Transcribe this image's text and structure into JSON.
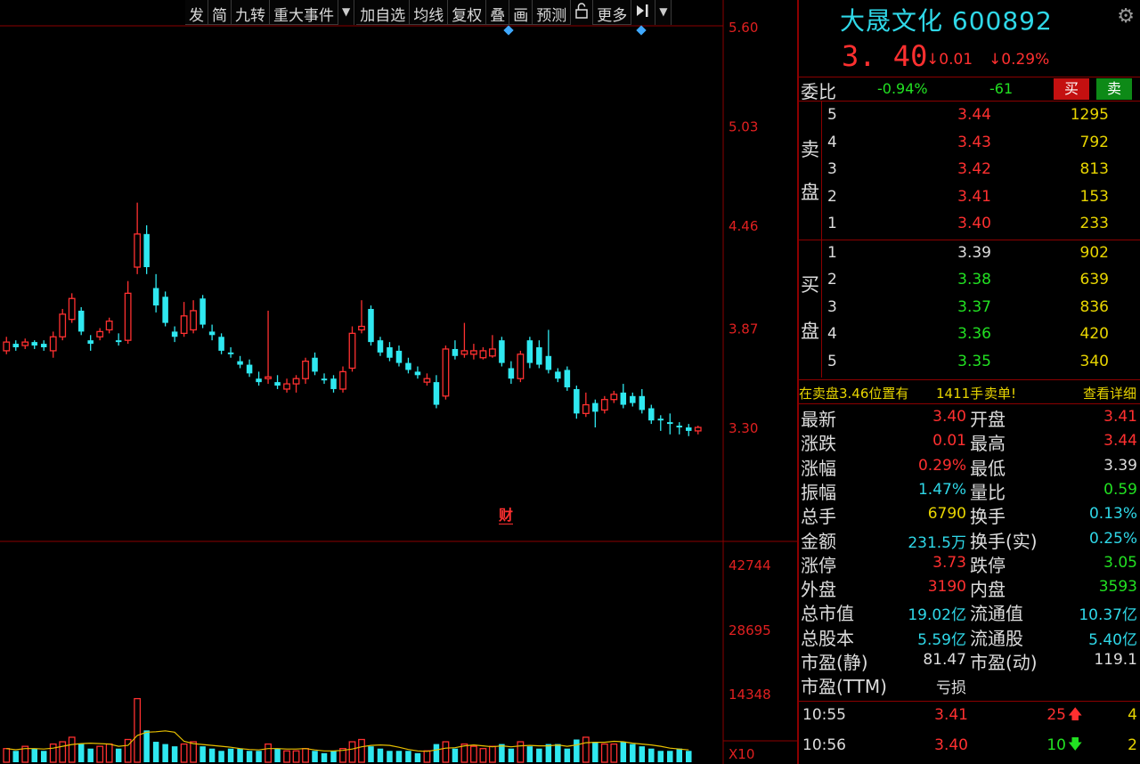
{
  "toolbar": {
    "items": [
      "发",
      "简",
      "九转",
      "重大事件",
      "加自选",
      "均线",
      "复权",
      "叠",
      "画",
      "预测",
      "更多"
    ]
  },
  "chart_data": {
    "type": "candlestick",
    "price_axis": {
      "ticks": [
        "5.60",
        "5.03",
        "4.46",
        "3.87",
        "3.30"
      ],
      "ylim": [
        3.3,
        5.6
      ]
    },
    "volume_axis": {
      "ticks": [
        "42744",
        "28695",
        "14348"
      ],
      "unit_label": "X10"
    },
    "candles": [
      {
        "o": 3.74,
        "c": 3.79,
        "h": 3.82,
        "l": 3.72
      },
      {
        "o": 3.78,
        "c": 3.76,
        "h": 3.8,
        "l": 3.74
      },
      {
        "o": 3.77,
        "c": 3.79,
        "h": 3.81,
        "l": 3.75
      },
      {
        "o": 3.79,
        "c": 3.77,
        "h": 3.8,
        "l": 3.75
      },
      {
        "o": 3.78,
        "c": 3.76,
        "h": 3.8,
        "l": 3.74
      },
      {
        "o": 3.74,
        "c": 3.82,
        "h": 3.85,
        "l": 3.7
      },
      {
        "o": 3.82,
        "c": 3.95,
        "h": 3.98,
        "l": 3.8
      },
      {
        "o": 3.92,
        "c": 4.04,
        "h": 4.07,
        "l": 3.9
      },
      {
        "o": 3.97,
        "c": 3.85,
        "h": 3.99,
        "l": 3.83
      },
      {
        "o": 3.8,
        "c": 3.78,
        "h": 3.83,
        "l": 3.74
      },
      {
        "o": 3.82,
        "c": 3.85,
        "h": 3.87,
        "l": 3.8
      },
      {
        "o": 3.86,
        "c": 3.91,
        "h": 3.93,
        "l": 3.84
      },
      {
        "o": 3.8,
        "c": 3.79,
        "h": 3.84,
        "l": 3.77
      },
      {
        "o": 3.8,
        "c": 4.07,
        "h": 4.14,
        "l": 3.78
      },
      {
        "o": 4.22,
        "c": 4.41,
        "h": 4.59,
        "l": 4.18
      },
      {
        "o": 4.41,
        "c": 4.22,
        "h": 4.46,
        "l": 4.18
      },
      {
        "o": 4.1,
        "c": 4.0,
        "h": 4.18,
        "l": 3.96
      },
      {
        "o": 4.05,
        "c": 3.9,
        "h": 4.08,
        "l": 3.88
      },
      {
        "o": 3.85,
        "c": 3.82,
        "h": 3.88,
        "l": 3.79
      },
      {
        "o": 3.84,
        "c": 3.94,
        "h": 4.02,
        "l": 3.82
      },
      {
        "o": 3.86,
        "c": 3.97,
        "h": 4.03,
        "l": 3.84
      },
      {
        "o": 4.04,
        "c": 3.89,
        "h": 4.06,
        "l": 3.87
      },
      {
        "o": 3.85,
        "c": 3.83,
        "h": 3.89,
        "l": 3.8
      },
      {
        "o": 3.82,
        "c": 3.74,
        "h": 3.84,
        "l": 3.72
      },
      {
        "o": 3.73,
        "c": 3.72,
        "h": 3.76,
        "l": 3.7
      },
      {
        "o": 3.68,
        "c": 3.66,
        "h": 3.71,
        "l": 3.64
      },
      {
        "o": 3.66,
        "c": 3.61,
        "h": 3.69,
        "l": 3.59
      },
      {
        "o": 3.58,
        "c": 3.56,
        "h": 3.62,
        "l": 3.54
      },
      {
        "o": 3.58,
        "c": 3.59,
        "h": 3.97,
        "l": 3.55
      },
      {
        "o": 3.56,
        "c": 3.54,
        "h": 3.6,
        "l": 3.52
      },
      {
        "o": 3.52,
        "c": 3.55,
        "h": 3.58,
        "l": 3.5
      },
      {
        "o": 3.55,
        "c": 3.58,
        "h": 3.6,
        "l": 3.5
      },
      {
        "o": 3.58,
        "c": 3.68,
        "h": 3.7,
        "l": 3.55
      },
      {
        "o": 3.7,
        "c": 3.62,
        "h": 3.73,
        "l": 3.6
      },
      {
        "o": 3.58,
        "c": 3.57,
        "h": 3.61,
        "l": 3.55
      },
      {
        "o": 3.58,
        "c": 3.52,
        "h": 3.6,
        "l": 3.5
      },
      {
        "o": 3.52,
        "c": 3.62,
        "h": 3.65,
        "l": 3.5
      },
      {
        "o": 3.64,
        "c": 3.84,
        "h": 3.88,
        "l": 3.62
      },
      {
        "o": 3.86,
        "c": 3.88,
        "h": 4.03,
        "l": 3.84
      },
      {
        "o": 3.98,
        "c": 3.79,
        "h": 4.0,
        "l": 3.77
      },
      {
        "o": 3.8,
        "c": 3.73,
        "h": 3.82,
        "l": 3.71
      },
      {
        "o": 3.76,
        "c": 3.7,
        "h": 3.79,
        "l": 3.68
      },
      {
        "o": 3.74,
        "c": 3.67,
        "h": 3.77,
        "l": 3.65
      },
      {
        "o": 3.67,
        "c": 3.63,
        "h": 3.7,
        "l": 3.61
      },
      {
        "o": 3.62,
        "c": 3.6,
        "h": 3.65,
        "l": 3.58
      },
      {
        "o": 3.56,
        "c": 3.58,
        "h": 3.61,
        "l": 3.54
      },
      {
        "o": 3.56,
        "c": 3.43,
        "h": 3.6,
        "l": 3.41
      },
      {
        "o": 3.48,
        "c": 3.75,
        "h": 3.77,
        "l": 3.46
      },
      {
        "o": 3.75,
        "c": 3.71,
        "h": 3.8,
        "l": 3.69
      },
      {
        "o": 3.72,
        "c": 3.74,
        "h": 3.9,
        "l": 3.7
      },
      {
        "o": 3.72,
        "c": 3.74,
        "h": 3.78,
        "l": 3.69
      },
      {
        "o": 3.7,
        "c": 3.74,
        "h": 3.76,
        "l": 3.69
      },
      {
        "o": 3.71,
        "c": 3.75,
        "h": 3.83,
        "l": 3.7
      },
      {
        "o": 3.8,
        "c": 3.67,
        "h": 3.82,
        "l": 3.65
      },
      {
        "o": 3.64,
        "c": 3.58,
        "h": 3.68,
        "l": 3.55
      },
      {
        "o": 3.58,
        "c": 3.72,
        "h": 3.74,
        "l": 3.56
      },
      {
        "o": 3.8,
        "c": 3.67,
        "h": 3.82,
        "l": 3.64
      },
      {
        "o": 3.76,
        "c": 3.66,
        "h": 3.8,
        "l": 3.64
      },
      {
        "o": 3.71,
        "c": 3.63,
        "h": 3.86,
        "l": 3.61
      },
      {
        "o": 3.62,
        "c": 3.58,
        "h": 3.64,
        "l": 3.56
      },
      {
        "o": 3.63,
        "c": 3.53,
        "h": 3.65,
        "l": 3.51
      },
      {
        "o": 3.52,
        "c": 3.38,
        "h": 3.54,
        "l": 3.35
      },
      {
        "o": 3.38,
        "c": 3.43,
        "h": 3.5,
        "l": 3.36
      },
      {
        "o": 3.44,
        "c": 3.39,
        "h": 3.46,
        "l": 3.3
      },
      {
        "o": 3.4,
        "c": 3.46,
        "h": 3.48,
        "l": 3.38
      },
      {
        "o": 3.46,
        "c": 3.49,
        "h": 3.51,
        "l": 3.44
      },
      {
        "o": 3.5,
        "c": 3.43,
        "h": 3.55,
        "l": 3.41
      },
      {
        "o": 3.48,
        "c": 3.44,
        "h": 3.5,
        "l": 3.42
      },
      {
        "o": 3.48,
        "c": 3.4,
        "h": 3.52,
        "l": 3.38
      },
      {
        "o": 3.41,
        "c": 3.34,
        "h": 3.43,
        "l": 3.32
      },
      {
        "o": 3.35,
        "c": 3.34,
        "h": 3.37,
        "l": 3.28
      },
      {
        "o": 3.33,
        "c": 3.32,
        "h": 3.38,
        "l": 3.26
      },
      {
        "o": 3.31,
        "c": 3.3,
        "h": 3.33,
        "l": 3.26
      },
      {
        "o": 3.3,
        "c": 3.28,
        "h": 3.32,
        "l": 3.25
      },
      {
        "o": 3.28,
        "c": 3.3,
        "h": 3.31,
        "l": 3.26
      }
    ],
    "volumes": [
      6,
      5,
      7,
      6,
      5,
      8,
      9,
      11,
      8,
      6,
      7,
      8,
      6,
      10,
      28,
      14,
      9,
      8,
      7,
      8,
      9,
      7,
      6,
      5,
      6,
      6,
      5,
      5,
      8,
      6,
      5,
      5,
      6,
      5,
      4,
      5,
      6,
      9,
      10,
      7,
      6,
      5,
      5,
      5,
      4,
      5,
      8,
      9,
      6,
      8,
      7,
      6,
      7,
      8,
      6,
      9,
      7,
      6,
      8,
      8,
      6,
      10,
      11,
      9,
      8,
      8,
      9,
      8,
      7,
      6,
      5,
      5,
      6,
      5
    ]
  },
  "badge_cai": "财",
  "stock": {
    "name": "大晟文化",
    "code": "600892",
    "price": "3. 40",
    "change": "0.01",
    "change_pct": "0.29%"
  },
  "ratio": {
    "label": "委比",
    "pct": "-0.94%",
    "val": "-61",
    "buy_btn": "买",
    "sell_btn": "卖"
  },
  "orderbook": {
    "sell_label": [
      "卖",
      "盘"
    ],
    "buy_label": [
      "买",
      "盘"
    ],
    "sell": [
      {
        "lvl": "5",
        "price": "3.44",
        "vol": "1295"
      },
      {
        "lvl": "4",
        "price": "3.43",
        "vol": "792"
      },
      {
        "lvl": "3",
        "price": "3.42",
        "vol": "813"
      },
      {
        "lvl": "2",
        "price": "3.41",
        "vol": "153"
      },
      {
        "lvl": "1",
        "price": "3.40",
        "vol": "233"
      }
    ],
    "buy": [
      {
        "lvl": "1",
        "price": "3.39",
        "vol": "902"
      },
      {
        "lvl": "2",
        "price": "3.38",
        "vol": "639"
      },
      {
        "lvl": "3",
        "price": "3.37",
        "vol": "836"
      },
      {
        "lvl": "4",
        "price": "3.36",
        "vol": "420"
      },
      {
        "lvl": "5",
        "price": "3.35",
        "vol": "340"
      }
    ]
  },
  "alert": {
    "text": "在卖盘3.46位置有",
    "vol": "1411手",
    "kind": "卖单!",
    "link": "查看详细"
  },
  "stats": [
    {
      "l1": "最新",
      "v1": "3.40",
      "c1": "red",
      "l2": "开盘",
      "v2": "3.41",
      "c2": "red"
    },
    {
      "l1": "涨跌",
      "v1": "0.01",
      "c1": "red",
      "l2": "最高",
      "v2": "3.44",
      "c2": "red"
    },
    {
      "l1": "涨幅",
      "v1": "0.29%",
      "c1": "red",
      "l2": "最低",
      "v2": "3.39",
      "c2": "white"
    },
    {
      "l1": "振幅",
      "v1": "1.47%",
      "c1": "cyan",
      "l2": "量比",
      "v2": "0.59",
      "c2": "green"
    },
    {
      "l1": "总手",
      "v1": "6790",
      "c1": "yellow",
      "l2": "换手",
      "v2": "0.13%",
      "c2": "cyan"
    },
    {
      "l1": "金额",
      "v1": "231.5万",
      "c1": "cyan",
      "l2": "换手(实)",
      "v2": "0.25%",
      "c2": "cyan"
    },
    {
      "l1": "涨停",
      "v1": "3.73",
      "c1": "red",
      "l2": "跌停",
      "v2": "3.05",
      "c2": "green"
    },
    {
      "l1": "外盘",
      "v1": "3190",
      "c1": "red",
      "l2": "内盘",
      "v2": "3593",
      "c2": "green"
    },
    {
      "l1": "总市值",
      "v1": "19.02亿",
      "c1": "cyan",
      "l2": "流通值",
      "v2": "10.37亿",
      "c2": "cyan"
    },
    {
      "l1": "总股本",
      "v1": "5.59亿",
      "c1": "cyan",
      "l2": "流通股",
      "v2": "5.40亿",
      "c2": "cyan"
    },
    {
      "l1": "市盈(静)",
      "v1": "81.47",
      "c1": "white",
      "l2": "市盈(动)",
      "v2": "119.1",
      "c2": "white"
    },
    {
      "l1": "市盈(TTM)",
      "v1": "亏损",
      "c1": "white",
      "l2": "",
      "v2": "",
      "c2": "white"
    }
  ],
  "ticks": [
    {
      "time": "10:55",
      "price": "3.41",
      "vol": "25",
      "dir": "up",
      "cnt": "4"
    },
    {
      "time": "10:56",
      "price": "3.40",
      "vol": "10",
      "dir": "down",
      "cnt": "2"
    }
  ],
  "colors": {
    "up": "#ff3030",
    "down": "#2fe8f0",
    "grid": "#8b0000",
    "ma": "#e8c000"
  }
}
